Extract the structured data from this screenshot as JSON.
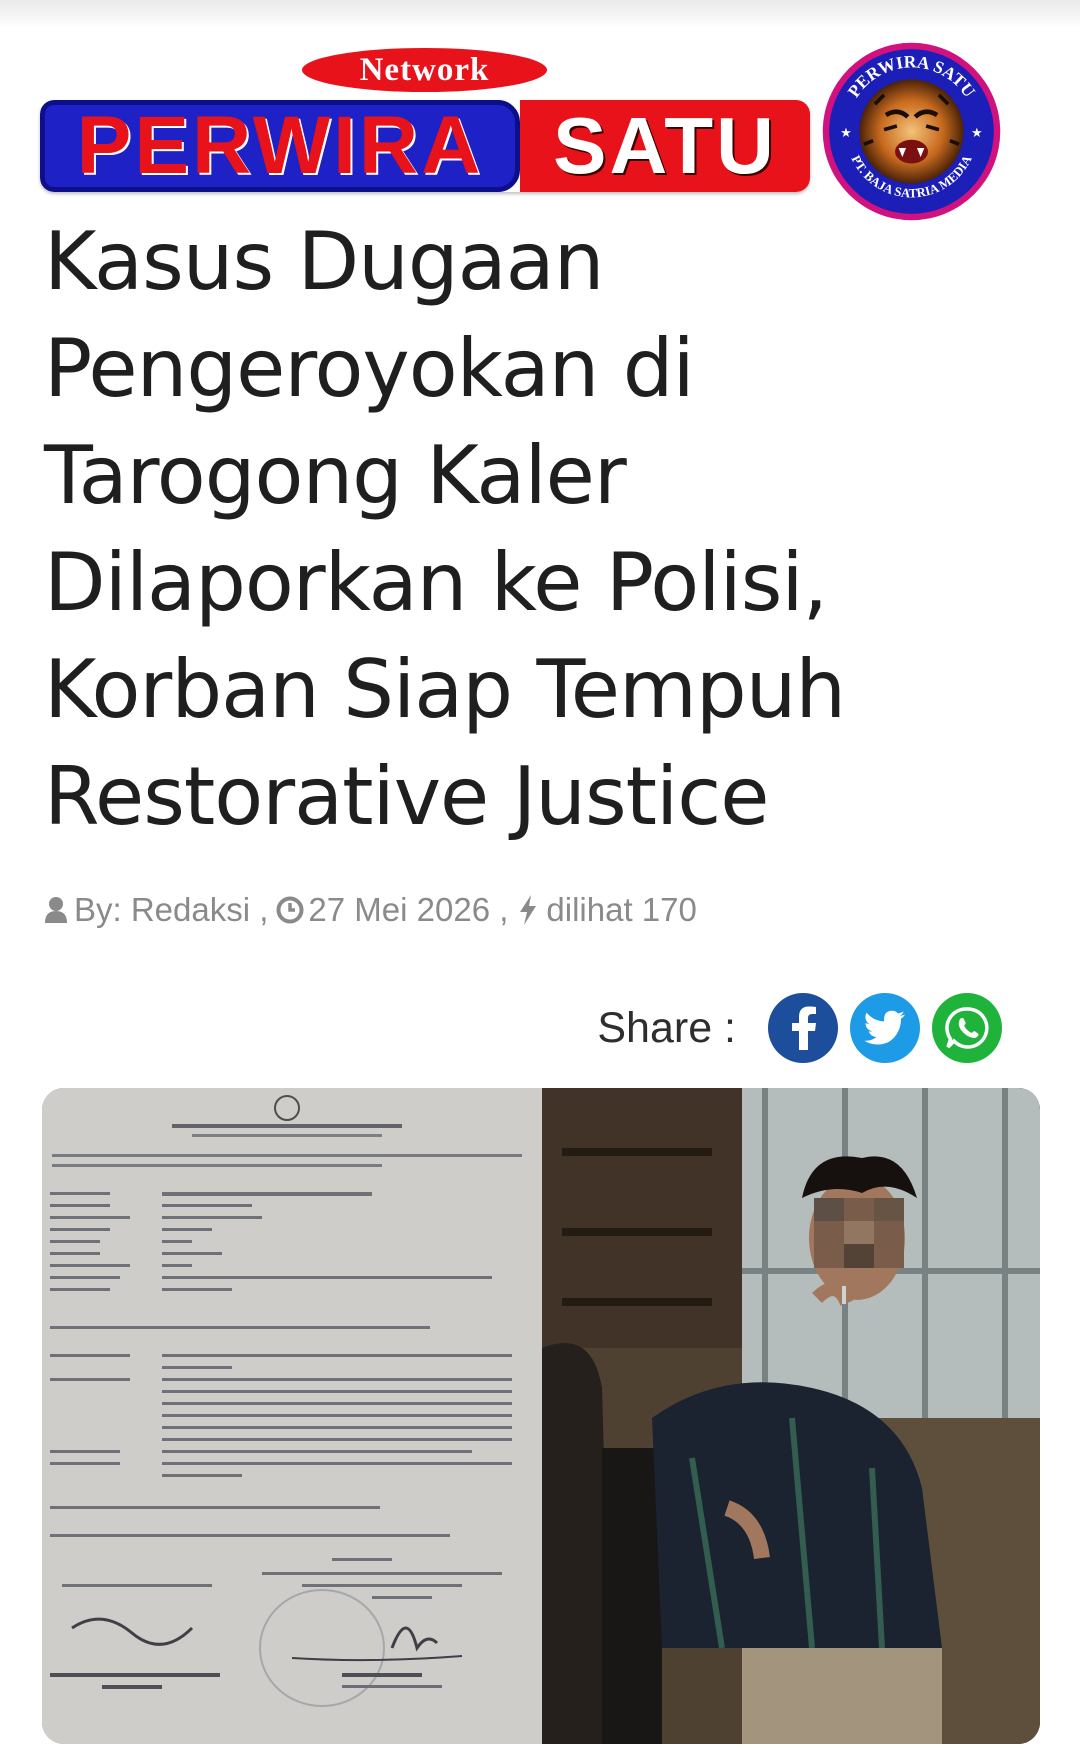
{
  "logo": {
    "network": "Network",
    "left": "PERWIRA",
    "right": "SATU"
  },
  "emblem": {
    "top_text": "PERWIRA SATU",
    "bottom_text": "PT. BAJA SATRIA MEDIA"
  },
  "article": {
    "title_lines": [
      "Kasus Dugaan",
      "Pengeroyokan di",
      "Tarogong Kaler",
      "Dilaporkan ke Polisi,",
      "Korban Siap Tempuh",
      "Restorative Justice"
    ],
    "author": "By: Redaksi ,",
    "date": "27 Mei 2026 ,",
    "views": "dilihat 170"
  },
  "share": {
    "label": "Share :"
  },
  "colors": {
    "brand_blue": "#1d21c6",
    "brand_red": "#e8121a",
    "facebook": "#1d4e9c",
    "twitter": "#1d9be7",
    "whatsapp": "#1fb33b"
  },
  "icons": [
    "user-icon",
    "clock-icon",
    "bolt-icon",
    "facebook-icon",
    "twitter-icon",
    "whatsapp-icon"
  ]
}
